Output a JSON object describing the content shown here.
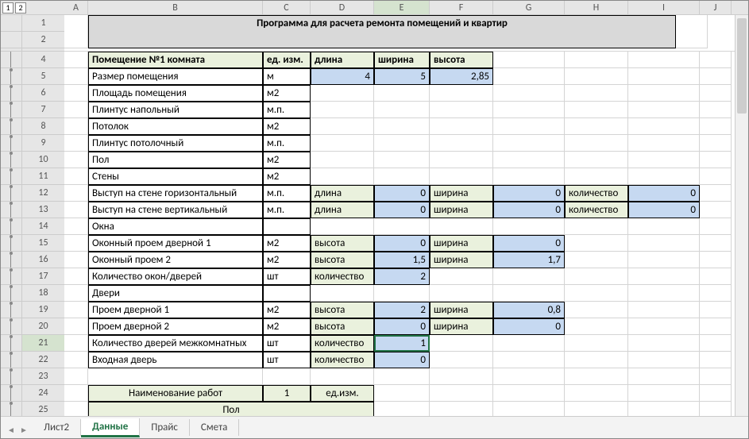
{
  "outline": {
    "btn1": "1",
    "btn2": "2"
  },
  "columns": [
    "A",
    "B",
    "C",
    "D",
    "E",
    "F",
    "G",
    "H",
    "I",
    "J"
  ],
  "rows": [
    "1",
    "2",
    "",
    "4",
    "5",
    "6",
    "7",
    "8",
    "9",
    "10",
    "11",
    "12",
    "13",
    "14",
    "15",
    "16",
    "17",
    "18",
    "19",
    "20",
    "21",
    "22",
    "23",
    "24",
    "25"
  ],
  "title": "Программа для расчета ремонта помещений и квартир",
  "hdr": {
    "room": "Помещение №1 комната",
    "unit": "ед. изм.",
    "len": "длина",
    "wid": "ширина",
    "hei": "высота"
  },
  "r5": {
    "b": "Размер помещения",
    "c": "м",
    "d": "4",
    "e": "5",
    "f": "2,85"
  },
  "r6": {
    "b": "Площадь помещения",
    "c": "м2"
  },
  "r7": {
    "b": "Плинтус напольный",
    "c": "м.п."
  },
  "r8": {
    "b": "Потолок",
    "c": "м2"
  },
  "r9": {
    "b": "Плинтус потолочный",
    "c": "м.п."
  },
  "r10": {
    "b": "Пол",
    "c": "м2"
  },
  "r11": {
    "b": "Стены",
    "c": "м2"
  },
  "r12": {
    "b": "Выступ на стене горизонтальный",
    "c": "м.п.",
    "d": "длина",
    "e": "0",
    "f": "ширина",
    "g": "0",
    "h": "количество",
    "i": "0"
  },
  "r13": {
    "b": "Выступ на стене вертикальный",
    "c": "м.п.",
    "d": "длина",
    "e": "0",
    "f": "ширина",
    "g": "0",
    "h": "количество",
    "i": "0"
  },
  "r14": {
    "b": "Окна"
  },
  "r15": {
    "b": "Оконный проем дверной 1",
    "c": "м2",
    "d": "высота",
    "e": "0",
    "f": "ширина",
    "g": "0"
  },
  "r16": {
    "b": "Оконный проем 2",
    "c": "м2",
    "d": "высота",
    "e": "1,5",
    "f": "ширина",
    "g": "1,7"
  },
  "r17": {
    "b": "Количество окон/дверей",
    "c": "шт",
    "d": "количество",
    "e": "2"
  },
  "r18": {
    "b": "Двери"
  },
  "r19": {
    "b": "Проем дверной 1",
    "c": "м2",
    "d": "высота",
    "e": "2",
    "f": "ширина",
    "g": "0,8"
  },
  "r20": {
    "b": "Проем дверной 2",
    "c": "м2",
    "d": "высота",
    "e": "0",
    "f": "ширина",
    "g": "0"
  },
  "r21": {
    "b": "Количество дверей межкомнатных",
    "c": "шт",
    "d": "количество",
    "e": "1"
  },
  "r22": {
    "b": "Входная дверь",
    "c": "шт",
    "d": "количество",
    "e": "0"
  },
  "r24": {
    "b": "Наименование работ",
    "c": "1",
    "d": "ед.изм."
  },
  "r25": {
    "b": "Пол"
  },
  "tabs": {
    "t1": "Лист2",
    "t2": "Данные",
    "t3": "Прайс",
    "t4": "Смета"
  }
}
